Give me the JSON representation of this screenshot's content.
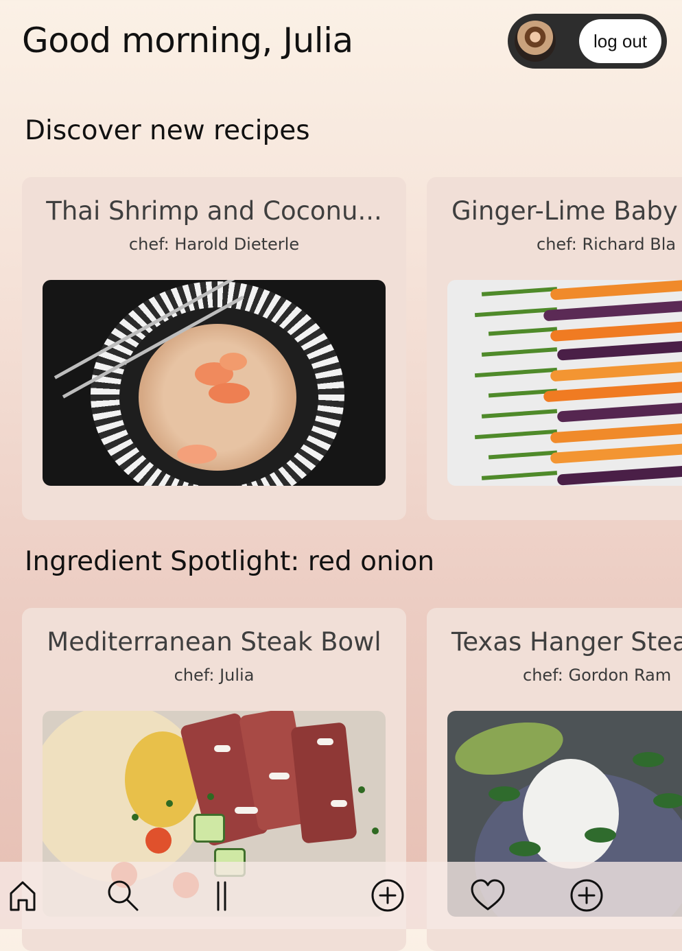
{
  "header": {
    "greeting": "Good morning, Julia",
    "logout_label": "log out"
  },
  "sections": {
    "discover": {
      "title": "Discover new recipes",
      "cards": [
        {
          "title": "Thai Shrimp and Coconu...",
          "chef": "chef: Harold Dieterle"
        },
        {
          "title": "Ginger-Lime Baby",
          "chef": "chef: Richard Bla"
        }
      ]
    },
    "spotlight": {
      "title": "Ingredient Spotlight: red onion",
      "cards": [
        {
          "title": "Mediterranean Steak Bowl",
          "chef": "chef: Julia"
        },
        {
          "title": "Texas Hanger Stea",
          "chef": "chef: Gordon Ram"
        }
      ]
    }
  },
  "nav": {
    "items": [
      "home-icon",
      "search-icon",
      "pause-icon",
      "plus-circle-icon",
      "heart-icon",
      "plus-circle-icon"
    ]
  }
}
